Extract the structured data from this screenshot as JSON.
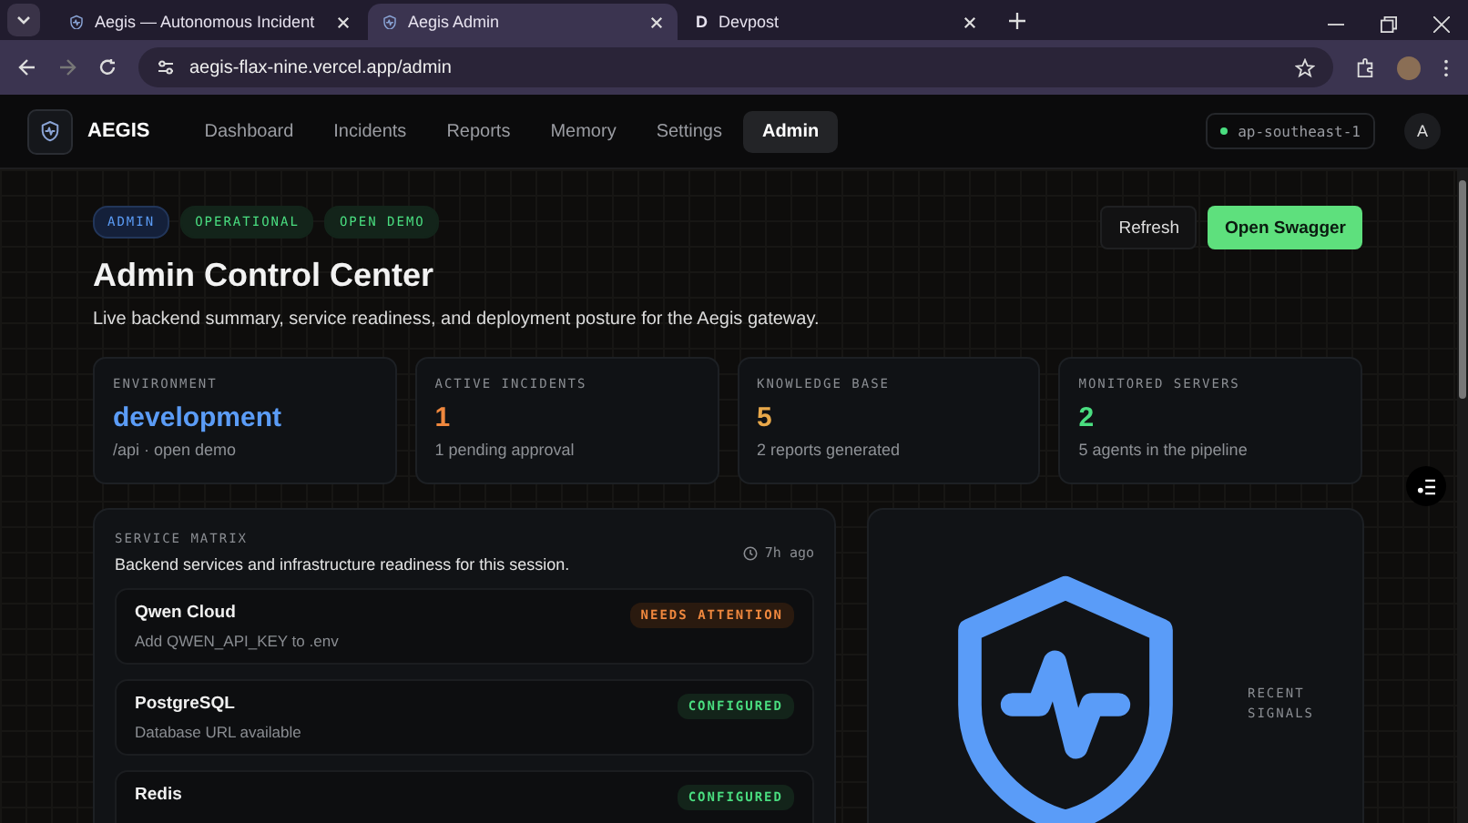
{
  "browser": {
    "tabs": [
      {
        "title": "Aegis — Autonomous Incident",
        "selected": false,
        "kind": "shield"
      },
      {
        "title": "Aegis Admin",
        "selected": true,
        "kind": "shield"
      },
      {
        "title": "Devpost",
        "selected": false,
        "kind": "letter",
        "favicon_letter": "D"
      }
    ],
    "url": "aegis-flax-nine.vercel.app/admin"
  },
  "header": {
    "brand": "AEGIS",
    "nav": [
      {
        "label": "Dashboard",
        "selected": false
      },
      {
        "label": "Incidents",
        "selected": false
      },
      {
        "label": "Reports",
        "selected": false
      },
      {
        "label": "Memory",
        "selected": false
      },
      {
        "label": "Settings",
        "selected": false
      },
      {
        "label": "Admin",
        "selected": true
      }
    ],
    "region": "ap-southeast-1",
    "avatar": "A"
  },
  "badges": [
    {
      "label": "ADMIN",
      "kind": "info"
    },
    {
      "label": "OPERATIONAL",
      "kind": "success"
    },
    {
      "label": "OPEN DEMO",
      "kind": "success"
    }
  ],
  "title": "Admin Control Center",
  "subtitle": "Live backend summary, service readiness, and deployment posture for the Aegis gateway.",
  "actions": [
    {
      "label": "Refresh",
      "kind": "secondary"
    },
    {
      "label": "Open Swagger",
      "kind": "primary"
    }
  ],
  "stats": [
    {
      "label": "ENVIRONMENT",
      "value": "development",
      "color": "#5b9cf6",
      "note": "/api · open demo"
    },
    {
      "label": "ACTIVE INCIDENTS",
      "value": "1",
      "color": "#f0883e",
      "note": "1 pending approval"
    },
    {
      "label": "KNOWLEDGE BASE",
      "value": "5",
      "color": "#e8a84a",
      "note": "2 reports generated"
    },
    {
      "label": "MONITORED SERVERS",
      "value": "2",
      "color": "#4ade80",
      "note": "5 agents in the pipeline"
    }
  ],
  "service_matrix": {
    "heading": "SERVICE MATRIX",
    "description": "Backend services and infrastructure readiness for this session.",
    "updated": "7h ago",
    "services": [
      {
        "name": "Qwen Cloud",
        "detail": "Add QWEN_API_KEY to .env",
        "status": "NEEDS ATTENTION",
        "kind": "warning"
      },
      {
        "name": "PostgreSQL",
        "detail": "Database URL available",
        "status": "CONFIGURED",
        "kind": "ok"
      },
      {
        "name": "Redis",
        "status": "CONFIGURED",
        "kind": "ok"
      }
    ]
  },
  "signals_panel": {
    "label": "RECENT SIGNALS"
  }
}
